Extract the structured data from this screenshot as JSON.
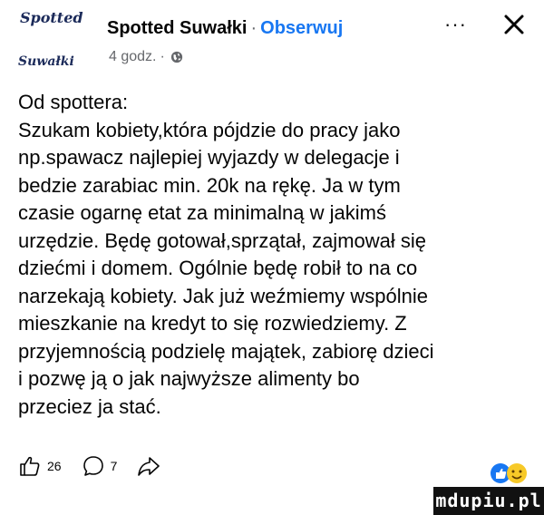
{
  "header": {
    "avatar_line1": "Spotted",
    "avatar_line2": "Suwałki",
    "page_name": "Spotted Suwałki",
    "separator": "·",
    "follow_label": "Obserwuj",
    "time": "4 godz.",
    "meta_separator": "·",
    "privacy_icon": "globe-icon",
    "more_label": "···",
    "close_icon": "close-icon"
  },
  "post": {
    "lines": [
      "Od spottera:",
      "Szukam kobiety,która pójdzie do pracy jako",
      "np.spawacz najlepiej wyjazdy w delegacje i",
      "bedzie zarabiac min. 20k na rękę. Ja w tym",
      "czasie ogarnę etat za minimalną w jakimś",
      "urzędzie. Będę gotował,sprzątał, zajmował się",
      "dziećmi i domem. Ogólnie będę robił to na co",
      "narzekają kobiety. Jak już weźmiemy wspólnie",
      "mieszkanie na kredyt to się rozwiedziemy. Z",
      "przyjemnością podzielę majątek, zabiorę dzieci",
      "i pozwę ją o jak najwyższe alimenty bo",
      "przeciez ja stać."
    ]
  },
  "actions": {
    "like_icon": "thumbs-up-icon",
    "like_count": "26",
    "comment_icon": "comment-icon",
    "comment_count": "7",
    "share_icon": "share-icon"
  },
  "colors": {
    "accent": "#1877f2",
    "text": "#050505",
    "muted": "#65676b",
    "reaction_blue": "#1877f2",
    "reaction_yellow": "#f7c928"
  },
  "watermark": {
    "text": "mdupiu.pl"
  }
}
